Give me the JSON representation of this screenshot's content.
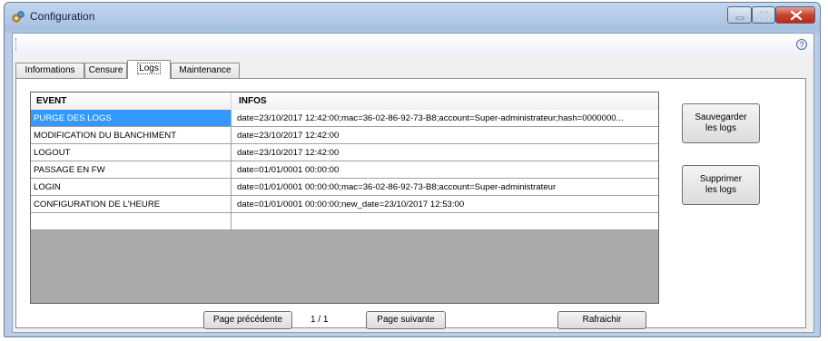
{
  "window": {
    "title": "Configuration"
  },
  "tabs": [
    {
      "label": "Informations",
      "active": false
    },
    {
      "label": "Censure",
      "active": false
    },
    {
      "label": "Logs",
      "active": true
    },
    {
      "label": "Maintenance",
      "active": false
    }
  ],
  "grid": {
    "columns": [
      "EVENT",
      "INFOS"
    ],
    "rows": [
      {
        "event": "PURGE DES LOGS",
        "infos": "date=23/10/2017 12:42:00;mac=36-02-86-92-73-B8;account=Super-administrateur;hash=0000000...",
        "selected": true
      },
      {
        "event": "MODIFICATION DU BLANCHIMENT",
        "infos": "date=23/10/2017 12:42:00",
        "selected": false
      },
      {
        "event": "LOGOUT",
        "infos": "date=23/10/2017 12:42:00",
        "selected": false
      },
      {
        "event": "PASSAGE EN FW",
        "infos": "date=01/01/0001 00:00:00",
        "selected": false
      },
      {
        "event": "LOGIN",
        "infos": "date=01/01/0001 00:00:00;mac=36-02-86-92-73-B8;account=Super-administrateur",
        "selected": false
      },
      {
        "event": "CONFIGURATION DE L'HEURE",
        "infos": "date=01/01/0001 00:00:00;new_date=23/10/2017 12:53:00",
        "selected": false
      },
      {
        "event": "",
        "infos": "",
        "selected": false
      }
    ]
  },
  "buttons": {
    "save_logs": "Sauvegarder les logs",
    "delete_logs": "Supprimer les logs",
    "prev_page": "Page précédente",
    "next_page": "Page suivante",
    "refresh": "Rafraichir"
  },
  "pagination": {
    "indicator": "1 / 1"
  },
  "colors": {
    "selection": "#3399ff",
    "grid_background": "#aaaaaa",
    "close_button": "#c8442e"
  },
  "icons": {
    "app": "settings-app-icon",
    "help": "help-icon"
  }
}
